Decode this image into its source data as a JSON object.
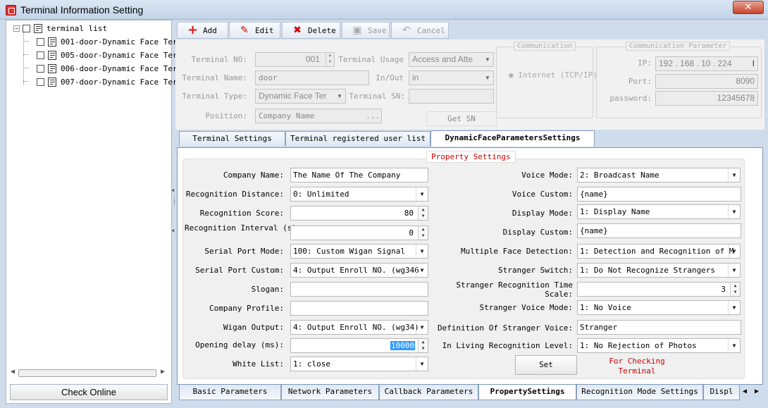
{
  "window": {
    "title": "Terminal Information Setting",
    "close_glyph": "✕"
  },
  "tree": {
    "root_label": "terminal list",
    "toggle": "−",
    "items": [
      "001-door-Dynamic Face Terr",
      "005-door-Dynamic Face Terr",
      "006-door-Dynamic Face Terr",
      "007-door-Dynamic Face Terr"
    ]
  },
  "check_online": "Check Online",
  "toolbar": {
    "add": "Add",
    "edit": "Edit",
    "delete": "Delete",
    "save": "Save",
    "cancel": "Cancel",
    "add_icon": "plus-icon",
    "edit_icon": "pencil-icon",
    "delete_icon": "x-icon",
    "save_icon": "disk-icon",
    "cancel_icon": "undo-icon"
  },
  "terminal_form": {
    "terminal_no_label": "Terminal NO:",
    "terminal_no": "001",
    "terminal_usage_label": "Terminal Usage",
    "terminal_usage": "Access and Atte",
    "terminal_name_label": "Terminal Name:",
    "terminal_name": "door",
    "inout_label": "In/Out",
    "inout": "in",
    "terminal_type_label": "Terminal Type:",
    "terminal_type": "Dynamic Face Ter",
    "terminal_sn_label": "Terminal SN:",
    "terminal_sn": "",
    "position_label": "Position:",
    "position": "Company Name",
    "position_btn": "...",
    "get_sn": "Get SN",
    "communication_title": "Communication",
    "internet_label": "Internet (TCP/IP)",
    "comm_param_title": "Communication Parameter",
    "ip_label": "IP:",
    "ip": [
      "192",
      "168",
      "10",
      "224"
    ],
    "ip_cursor": "I",
    "port_label": "Port:",
    "port": "8090",
    "password_label": "password:",
    "password": "12345678"
  },
  "tabs_top": [
    "Terminal Settings",
    "Terminal registered user list",
    "DynamicFaceParametersSettings"
  ],
  "property": {
    "title": "Property Settings",
    "left": [
      {
        "label": "Company Name:",
        "value": "The Name Of The Company",
        "kind": "text"
      },
      {
        "label": "Recognition Distance:",
        "value": "0: Unlimited",
        "kind": "dropdown"
      },
      {
        "label": "Recognition Score:",
        "value": "80",
        "kind": "spin"
      },
      {
        "label": "Recognition Interval (s):",
        "value": "0",
        "kind": "spin"
      },
      {
        "label": "Serial Port Mode:",
        "value": "100: Custom Wigan Signal",
        "kind": "dropdown"
      },
      {
        "label": "Serial Port Custom:",
        "value": "4: Output Enroll NO. (wg346",
        "kind": "dropdown"
      },
      {
        "label": "Slogan:",
        "value": "",
        "kind": "text"
      },
      {
        "label": "Company Profile:",
        "value": "",
        "kind": "text"
      },
      {
        "label": "Wigan Output:",
        "value": "4: Output Enroll NO. (wg34)",
        "kind": "dropdown"
      },
      {
        "label": "Opening delay (ms):",
        "value": "10000",
        "kind": "spin"
      },
      {
        "label": "White List:",
        "value": "1: close",
        "kind": "dropdown"
      }
    ],
    "right": [
      {
        "label": "Voice Mode:",
        "value": "2: Broadcast Name",
        "kind": "dropdown"
      },
      {
        "label": "Voice Custom:",
        "value": "{name}",
        "kind": "text"
      },
      {
        "label": "Display Mode:",
        "value": "1: Display Name",
        "kind": "dropdown"
      },
      {
        "label": "Display Custom:",
        "value": "{name}",
        "kind": "text"
      },
      {
        "label": "Multiple Face Detection:",
        "value": "1: Detection and Recognition of M",
        "kind": "dropdown"
      },
      {
        "label": "Stranger Switch:",
        "value": "1: Do Not Recognize Strangers",
        "kind": "dropdown"
      },
      {
        "label": "Stranger Recognition Time Scale:",
        "value": "3",
        "kind": "spin"
      },
      {
        "label": "Stranger Voice Mode:",
        "value": "1: No Voice",
        "kind": "dropdown"
      },
      {
        "label": "Definition Of Stranger Voice:",
        "value": "Stranger",
        "kind": "text"
      },
      {
        "label": "In Living Recognition Level:",
        "value": "1: No Rejection of Photos",
        "kind": "dropdown"
      }
    ],
    "set_button": "Set",
    "hint": "For Checking Terminal"
  },
  "tabs_bottom": [
    "Basic Parameters",
    "Network Parameters",
    "Callback Parameters",
    "PropertySettings",
    "Recognition Mode Settings",
    "Displ"
  ],
  "glyphs": {
    "dd": "▼",
    "up": "▲",
    "down": "▼",
    "left": "◀",
    "right": "▶",
    "radio": "◉"
  }
}
